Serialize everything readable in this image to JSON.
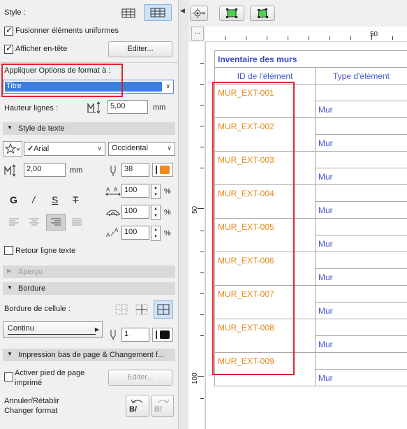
{
  "left_panel": {
    "style_label": "Style :",
    "merge_uniform": {
      "label": "Fusionner éléments uniformes",
      "checked": true
    },
    "show_header": {
      "label": "Afficher en-tête",
      "checked": true
    },
    "edit_button": "Editer...",
    "apply_format_label": "Appliquer Options de format à :",
    "apply_format_value": "Titre",
    "row_height_label": "Hauteur lignes :",
    "row_height_value": "5,00",
    "row_height_unit": "mm",
    "text_style_section": "Style de texte",
    "font_value": "Arial",
    "script_value": "Occidental",
    "font_size_value": "2,00",
    "font_size_unit": "mm",
    "pen_value": "38",
    "width_pct": "100",
    "spacing_pct": "100",
    "height_pct": "100",
    "pct": "%",
    "bold_glyph": "G",
    "italic_glyph": "/",
    "underline_glyph": "S",
    "strike_glyph": "T",
    "wrap_text": {
      "label": "Retour ligne texte",
      "checked": false
    },
    "preview_section": "Aperçu",
    "border_section": "Bordure",
    "cell_border_label": "Bordure de cellule :",
    "line_type_value": "Continu",
    "border_pen_value": "1",
    "print_section": "Impression bas de page & Changement f...",
    "activate_footer": {
      "label_line1": "Activer pied de page",
      "label_line2": "imprimé",
      "checked": false
    },
    "edit_button_disabled": "Editer...",
    "undo_label_line1": "Annuler/Rétablir",
    "undo_label_line2": "Changer format",
    "undo_glyph": "B/",
    "colors": {
      "selection_blue": "#3a7ee0",
      "highlight_red": "#e0252b",
      "pen_orange": "#f08a1c"
    }
  },
  "ruler": {
    "top_label": "50",
    "left_label_1": "50",
    "left_label_2": "100",
    "corner_glyph": "..."
  },
  "schedule": {
    "title": "Inventaire des murs",
    "headers": [
      "ID de l'élément",
      "Type d'élément"
    ],
    "rows": [
      {
        "id": "MUR_EXT-001",
        "type": "Mur"
      },
      {
        "id": "MUR_EXT-002",
        "type": "Mur"
      },
      {
        "id": "MUR_EXT-003",
        "type": "Mur"
      },
      {
        "id": "MUR_EXT-004",
        "type": "Mur"
      },
      {
        "id": "MUR_EXT-005",
        "type": "Mur"
      },
      {
        "id": "MUR_EXT-006",
        "type": "Mur"
      },
      {
        "id": "MUR_EXT-007",
        "type": "Mur"
      },
      {
        "id": "MUR_EXT-008",
        "type": "Mur"
      },
      {
        "id": "MUR_EXT-009",
        "type": "Mur"
      }
    ],
    "colors": {
      "title": "#3c46c8",
      "id": "#e38a1e",
      "type": "#4a5cc8"
    }
  }
}
